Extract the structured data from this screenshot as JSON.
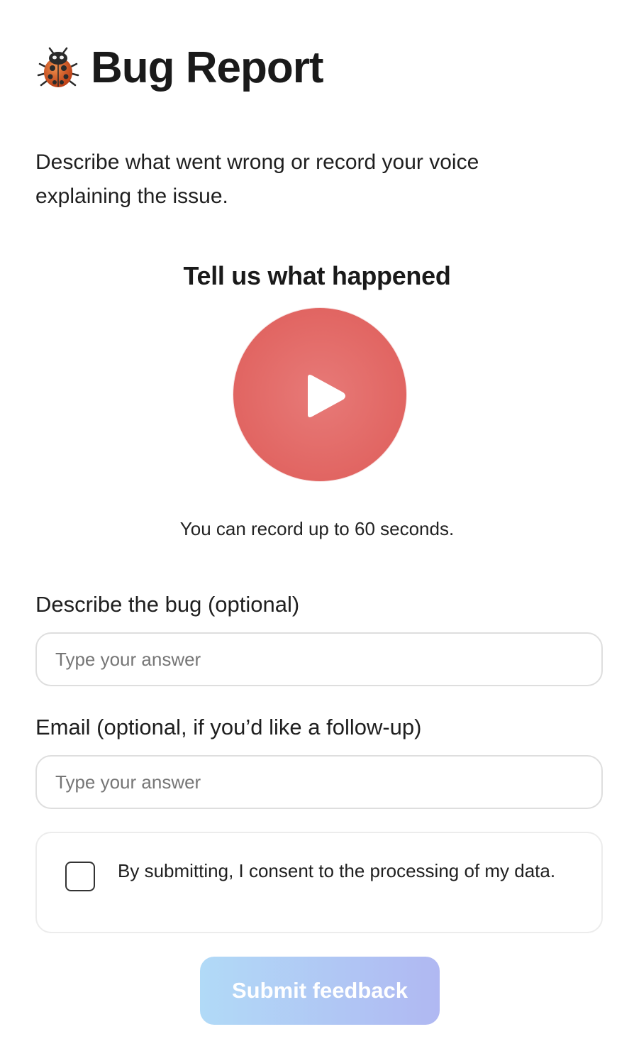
{
  "header": {
    "icon": "ladybug-icon",
    "title": "Bug Report"
  },
  "intro": {
    "text": "Describe what went wrong or record your voice explaining the issue."
  },
  "recorder": {
    "heading": "Tell us what happened",
    "button_icon": "play-icon",
    "button_color": "#e26865",
    "hint": "You can record up to 60 seconds."
  },
  "form": {
    "bug_field": {
      "label": "Describe the bug (optional)",
      "placeholder": "Type your answer",
      "value": ""
    },
    "email_field": {
      "label": "Email (optional, if you’d like a follow-up)",
      "placeholder": "Type your answer",
      "value": ""
    },
    "consent": {
      "checked": false,
      "text": "By submitting, I consent to the processing of my data."
    },
    "submit_label": "Submit feedback"
  },
  "colors": {
    "submit_gradient_start": "#b1daf7",
    "submit_gradient_end": "#b0b8f2"
  }
}
